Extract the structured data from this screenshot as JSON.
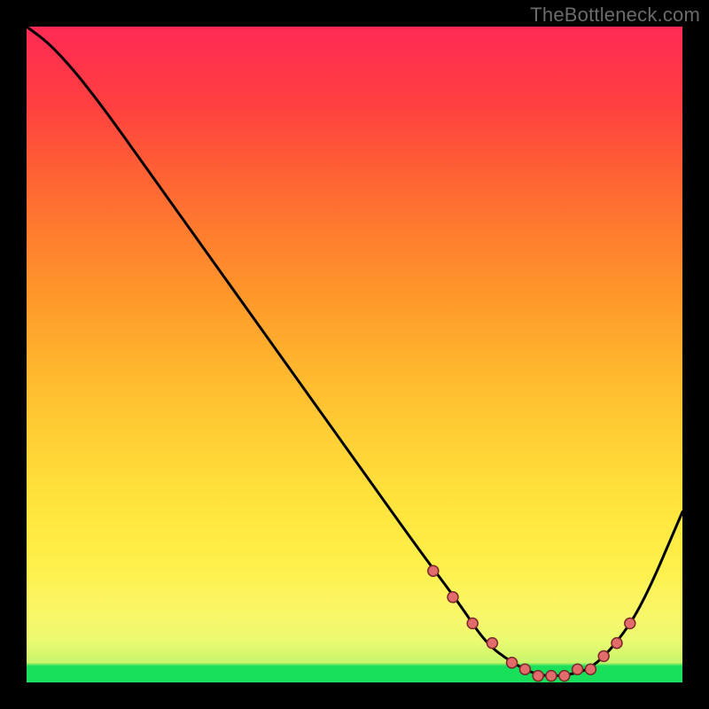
{
  "watermark": "TheBottleneck.com",
  "chart_data": {
    "type": "line",
    "title": "",
    "xlabel": "",
    "ylabel": "",
    "xlim": [
      0,
      100
    ],
    "ylim": [
      0,
      100
    ],
    "grid": false,
    "legend": false,
    "background_gradient": {
      "direction": "vertical",
      "stops": [
        {
          "pos": 0.0,
          "color": "#19e05a"
        },
        {
          "pos": 0.03,
          "color": "#c8f56c"
        },
        {
          "pos": 0.1,
          "color": "#f8f76a"
        },
        {
          "pos": 0.3,
          "color": "#ffe33c"
        },
        {
          "pos": 0.5,
          "color": "#ffb62e"
        },
        {
          "pos": 0.7,
          "color": "#ff7e2e"
        },
        {
          "pos": 0.9,
          "color": "#ff4040"
        },
        {
          "pos": 1.0,
          "color": "#ff2a55"
        }
      ]
    },
    "series": [
      {
        "name": "bottleneck-curve",
        "x": [
          0,
          4,
          10,
          20,
          30,
          40,
          50,
          60,
          66,
          70,
          74,
          78,
          82,
          86,
          90,
          94,
          100
        ],
        "y": [
          100,
          97,
          90,
          76,
          62,
          48,
          34,
          20,
          12,
          6,
          3,
          1,
          1,
          2,
          6,
          12,
          26
        ]
      }
    ],
    "markers": {
      "name": "highlight-dots",
      "color": "#e26b6b",
      "x": [
        62,
        65,
        68,
        71,
        74,
        76,
        78,
        80,
        82,
        84,
        86,
        88,
        90,
        92
      ],
      "y": [
        17,
        13,
        9,
        6,
        3,
        2,
        1,
        1,
        1,
        2,
        2,
        4,
        6,
        9
      ]
    }
  }
}
